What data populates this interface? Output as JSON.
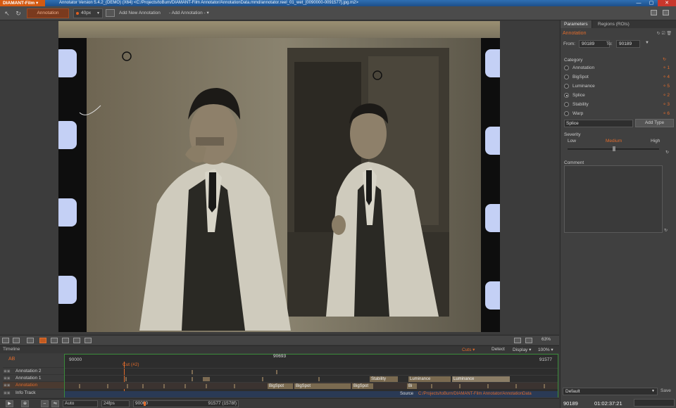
{
  "titlebar": {
    "app_menu": "DIAMANT-Film ▾",
    "title": "Annotator Version 5.4.2_(DEMO) (X64) <C:/Projects/toBurn/DIAMANT-Film Annotator/AnnotationData.mmd/annotator.reel_01_wet_[0090000-0091577].jpg.m2>",
    "min": "—",
    "max": "▢",
    "close": "✕"
  },
  "toolbar": {
    "annotation_label": "Annotation",
    "size_value": "40px",
    "add_new_label": "Add New Annotation",
    "add_dropdown_label": "- Add Annotation -  ▾"
  },
  "viewer": {
    "zoom": "63%"
  },
  "panel": {
    "tabs": [
      "Parameters",
      "Regions (ROIs)"
    ],
    "section_title": "Annotation",
    "from_label": "From:",
    "from_value": "90189",
    "to_label": "To:",
    "to_value": "90189",
    "category_label": "Category",
    "categories": [
      {
        "label": "Annotation",
        "key": "1",
        "selected": false
      },
      {
        "label": "BigSpot",
        "key": "4",
        "selected": false
      },
      {
        "label": "Luminance",
        "key": "5",
        "selected": false
      },
      {
        "label": "Splice",
        "key": "2",
        "selected": true
      },
      {
        "label": "Stability",
        "key": "3",
        "selected": false
      },
      {
        "label": "Warp",
        "key": "6",
        "selected": false
      }
    ],
    "type_value": "Splice",
    "add_type_label": "Add Type",
    "severity_label": "Severity",
    "severity_low": "Low",
    "severity_medium": "Medium",
    "severity_high": "High",
    "severity_level": 0.5,
    "comment_label": "Comment",
    "preset_value": "Default",
    "save_label": "Save",
    "frame": "90189",
    "timecode": "01:02:37:21"
  },
  "timeline": {
    "title": "Timeline",
    "cuts_label": "Cuts ▾",
    "detect_label": "Detect",
    "display_label": "Display ▾",
    "zoom_label": "100% ▾",
    "ab_label": "AB",
    "start_frame": "90000",
    "mid_frame": "90693",
    "end_frame": "91577",
    "cut_label": "Cut (#2)",
    "tracks": [
      "Annotation 2",
      "Annotation 1",
      "Annotation",
      "Info Track"
    ],
    "segments": {
      "annotation1": [
        "Stability",
        "Luminance",
        "Luminance"
      ],
      "annotation": [
        "BigSpot",
        "BigSpot",
        "BigSpot",
        "Bi"
      ]
    },
    "source_label": "Source",
    "source_path": "C:/Projects/toBurn/DIAMANT-Film Annotator/AnnotationData"
  },
  "transport": {
    "auto_label": "Auto",
    "fps_label": "24fps",
    "range_start": "90000",
    "range_end": "91577 (1578f)"
  },
  "colors": {
    "accent": "#e06b2c",
    "app_brand": "#d45a12",
    "panel_bg": "#404040",
    "titlebar": "#2f6fb3"
  }
}
